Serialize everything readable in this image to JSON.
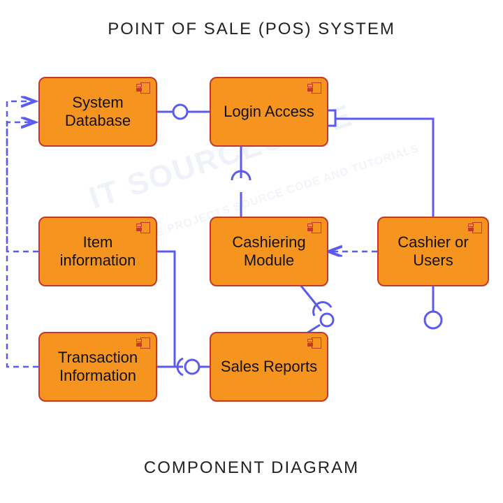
{
  "title": "POINT OF SALE (POS) SYSTEM",
  "subtitle": "COMPONENT DIAGRAM",
  "watermark": {
    "main": "IT SOURCECODE",
    "sub": "FREE PROJECTS SOURCE CODE AND TUTORIALS"
  },
  "components": {
    "system_database": "System Database",
    "login_access": "Login Access",
    "item_information": "Item information",
    "cashiering_module": "Cashiering Module",
    "cashier_users": "Cashier or Users",
    "transaction_information": "Transaction Information",
    "sales_reports": "Sales Reports"
  },
  "chart_data": {
    "type": "uml-component-diagram",
    "title": "POINT OF SALE (POS) SYSTEM",
    "nodes": [
      {
        "id": "system_database",
        "label": "System Database"
      },
      {
        "id": "login_access",
        "label": "Login Access"
      },
      {
        "id": "item_information",
        "label": "Item information"
      },
      {
        "id": "cashiering_module",
        "label": "Cashiering Module"
      },
      {
        "id": "cashier_users",
        "label": "Cashier or Users"
      },
      {
        "id": "transaction_information",
        "label": "Transaction Information"
      },
      {
        "id": "sales_reports",
        "label": "Sales Reports"
      }
    ],
    "edges": [
      {
        "from": "login_access",
        "to": "system_database",
        "style": "required-provided",
        "notation": "socket-ball"
      },
      {
        "from": "cashiering_module",
        "to": "login_access",
        "style": "required-provided",
        "notation": "socket-ball"
      },
      {
        "from": "sales_reports",
        "to": "cashiering_module",
        "style": "required-provided",
        "notation": "socket-ball"
      },
      {
        "from": "transaction_information",
        "to": "sales_reports",
        "style": "required-provided",
        "notation": "socket-ball"
      },
      {
        "from": "item_information",
        "to": "transaction_information",
        "style": "solid-join"
      },
      {
        "from": "cashier_users",
        "to": "login_access",
        "style": "provided-port",
        "notation": "port-square"
      },
      {
        "from": "cashier_users",
        "to": "lollipop",
        "style": "provided-interface",
        "notation": "ball"
      },
      {
        "from": "cashier_users",
        "to": "cashiering_module",
        "style": "dependency-dashed",
        "direction": "to"
      },
      {
        "from": "item_information",
        "to": "off-left",
        "style": "dependency-dashed"
      },
      {
        "from": "transaction_information",
        "to": "off-left",
        "style": "dependency-dashed"
      },
      {
        "from": "off-left",
        "to": "system_database",
        "style": "dependency-dashed",
        "direction": "to"
      }
    ]
  }
}
